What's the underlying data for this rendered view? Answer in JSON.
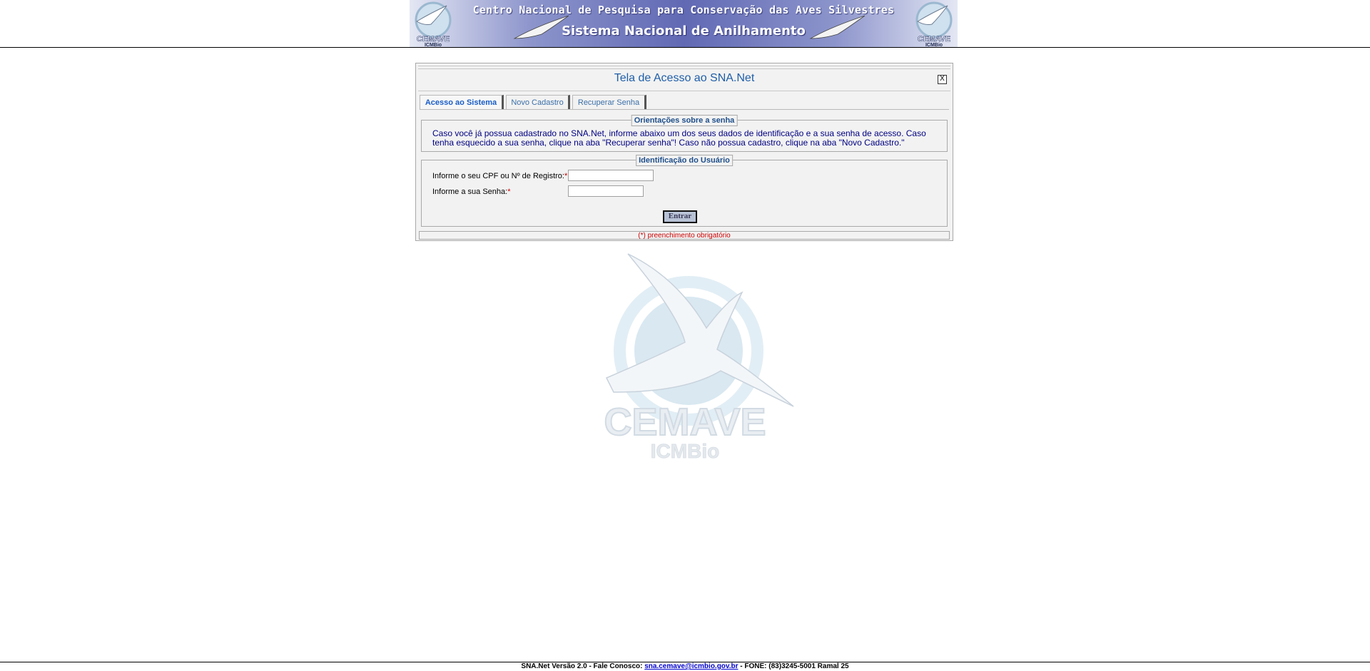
{
  "header": {
    "line1": "Centro Nacional de Pesquisa para Conservação das Aves Silvestres",
    "line2": "Sistema Nacional de Anilhamento",
    "logo_icon": "cemave-icmbio-logo"
  },
  "dialog": {
    "title": "Tela de Acesso ao SNA.Net",
    "close_label": "X",
    "tabs": [
      {
        "label": "Acesso ao Sistema",
        "active": true
      },
      {
        "label": "Novo Cadastro",
        "active": false
      },
      {
        "label": "Recuperar Senha",
        "active": false
      }
    ],
    "orientation": {
      "legend": "Orientações sobre a senha",
      "text": "Caso você já possua cadastrado no SNA.Net, informe abaixo um dos seus dados de identificação e a sua senha de acesso. Caso tenha esquecido a sua senha, clique na aba \"Recuperar senha\"! Caso não possua cadastro, clique na aba \"Novo Cadastro.\""
    },
    "identification": {
      "legend": "Identificação do Usuário",
      "cpf_label": "Informe o seu CPF ou Nº de Registro:",
      "cpf_value": "",
      "senha_label": "Informe a sua Senha:",
      "senha_value": "",
      "required_mark": "*",
      "submit_label": "Entrar"
    },
    "required_note": "(*) preenchimento obrigatório"
  },
  "watermark": {
    "text_main": "CEMAVE",
    "text_sub": "ICMBio"
  },
  "footer": {
    "prefix": "SNA.Net Versão 2.0 - Fale Conosco: ",
    "email": "sna.cemave@icmbio.gov.br",
    "suffix": " - FONE: (83)3245-5001 Ramal 25"
  },
  "colors": {
    "banner_mid": "#6169b4",
    "title_blue": "#1f5ea8",
    "required_red": "#cc0000",
    "link_blue": "#0000cc"
  }
}
